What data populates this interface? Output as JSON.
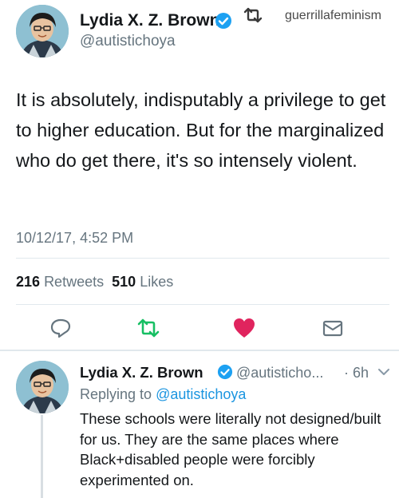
{
  "repost": {
    "icon": "retweet-icon",
    "username": "guerrillafeminism"
  },
  "main_tweet": {
    "author_name": "Lydia X. Z. Brown",
    "handle": "@autistichoya",
    "verified": true,
    "text": "It is absolutely, indisputably a privilege to get to higher education. But for the marginalized who do get there, it's so intensely violent.",
    "timestamp": "10/12/17, 4:52 PM",
    "retweets_count": "216",
    "retweets_label": "Retweets",
    "likes_count": "510",
    "likes_label": "Likes",
    "actions": [
      "reply-icon",
      "retweet-icon",
      "heart-icon",
      "envelope-icon"
    ],
    "colors": {
      "retweet": "#17bf63",
      "heart": "#e0245e",
      "muted": "#66757f",
      "verified": "#1da1f2"
    }
  },
  "reply_tweet": {
    "author_name": "Lydia X. Z. Brown",
    "handle": "@autisticho...",
    "separator": "·",
    "time": "6h",
    "replying_prefix": "Replying to",
    "replying_to": "@autistichoya",
    "text": "These schools were literally not designed/built for us. They are the same places where Black+disabled people were forcibly experimented on.",
    "link_color": "#1b95e0"
  }
}
